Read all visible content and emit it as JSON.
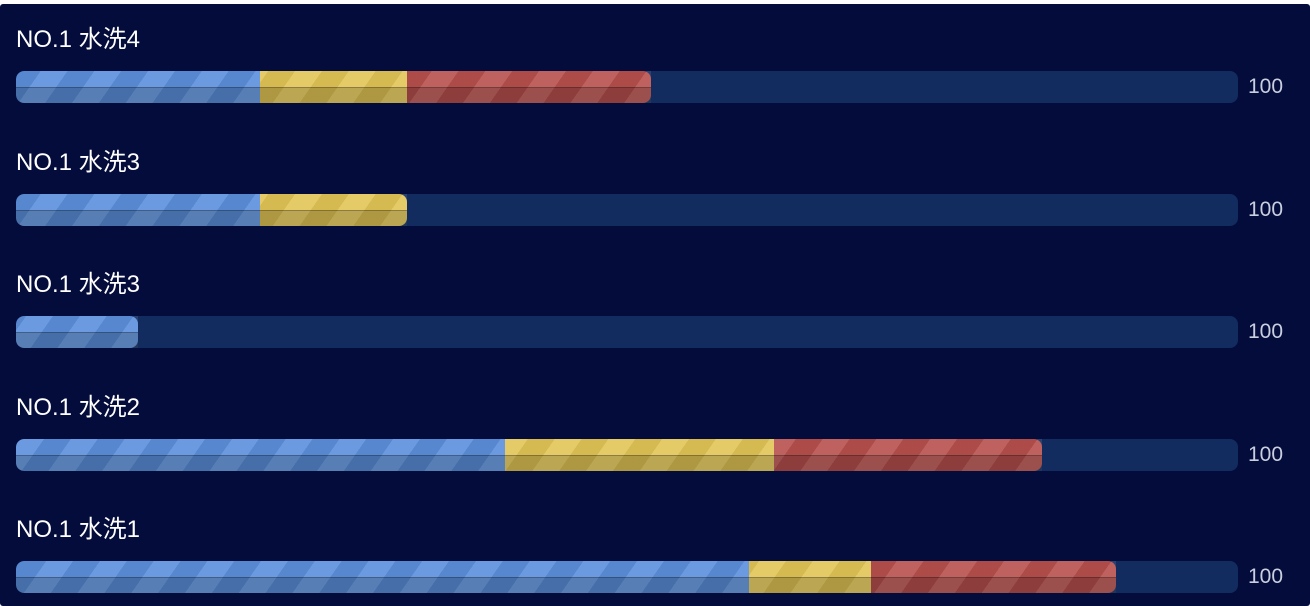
{
  "chart_data": {
    "type": "bar",
    "orientation": "horizontal",
    "stacked": true,
    "categories": [
      "NO.1 水洗4",
      "NO.1 水洗3",
      "NO.1 水洗3",
      "NO.1 水洗2",
      "NO.1 水洗1"
    ],
    "series": [
      {
        "color": "#5b8fdc",
        "values": [
          20,
          20,
          10,
          40,
          60
        ]
      },
      {
        "color": "#e2c556",
        "values": [
          12,
          12,
          0,
          22,
          10
        ]
      },
      {
        "color": "#b8504d",
        "values": [
          20,
          0,
          0,
          22,
          20
        ]
      }
    ],
    "max_labels": [
      "100",
      "100",
      "100",
      "100",
      "100"
    ],
    "xlim": [
      0,
      100
    ],
    "track_color": "#122c5f",
    "background": "#040c3b"
  }
}
